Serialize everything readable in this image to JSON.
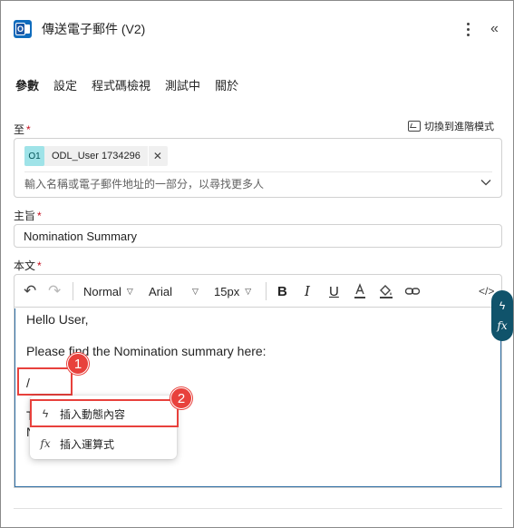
{
  "header": {
    "title": "傳送電子郵件 (V2)",
    "app_icon": "outlook-icon",
    "more_icon": "more-vertical-icon",
    "collapse_icon": "double-chevron-left-icon",
    "collapse_glyph": "«"
  },
  "tabs": [
    {
      "label": "參數",
      "active": true
    },
    {
      "label": "設定",
      "active": false
    },
    {
      "label": "程式碼檢視",
      "active": false
    },
    {
      "label": "測試中",
      "active": false
    },
    {
      "label": "關於",
      "active": false
    }
  ],
  "to_field": {
    "label": "至",
    "required_mark": "*",
    "advanced_mode_label": "切換到進階模式",
    "chip": {
      "avatar_text": "O1",
      "name": "ODL_User 1734296",
      "remove_glyph": "✕"
    },
    "placeholder": "輸入名稱或電子郵件地址的一部分，以尋找更多人"
  },
  "subject_field": {
    "label": "主旨",
    "required_mark": "*",
    "value": "Nomination Summary"
  },
  "body_field": {
    "label": "本文",
    "required_mark": "*",
    "toolbar": {
      "undo_glyph": "↶",
      "redo_glyph": "↷",
      "format_style": "Normal",
      "font": "Arial",
      "font_size": "15px",
      "bold_glyph": "B",
      "italic_glyph": "I",
      "underline_glyph": "U",
      "code_glyph": "</>"
    },
    "lines": [
      "Hello User,",
      "Please find the Nomination summary here:",
      "/",
      "T",
      "N"
    ]
  },
  "popup_menu": {
    "items": [
      {
        "label": "插入動態內容",
        "icon": "lightning-icon",
        "glyph": "ϟ"
      },
      {
        "label": "插入運算式",
        "icon": "fx-icon",
        "glyph": "fx"
      }
    ]
  },
  "side_pill": {
    "dynamic_glyph": "ϟ",
    "fx_glyph": "fx"
  },
  "annotations": {
    "callout_1": "1",
    "callout_2": "2",
    "color": "#e8413c"
  },
  "colors": {
    "accent": "#0f6cbd",
    "side_pill": "#10536b",
    "required": "#c50f1f",
    "chip_avatar": "#9fe3e8"
  }
}
